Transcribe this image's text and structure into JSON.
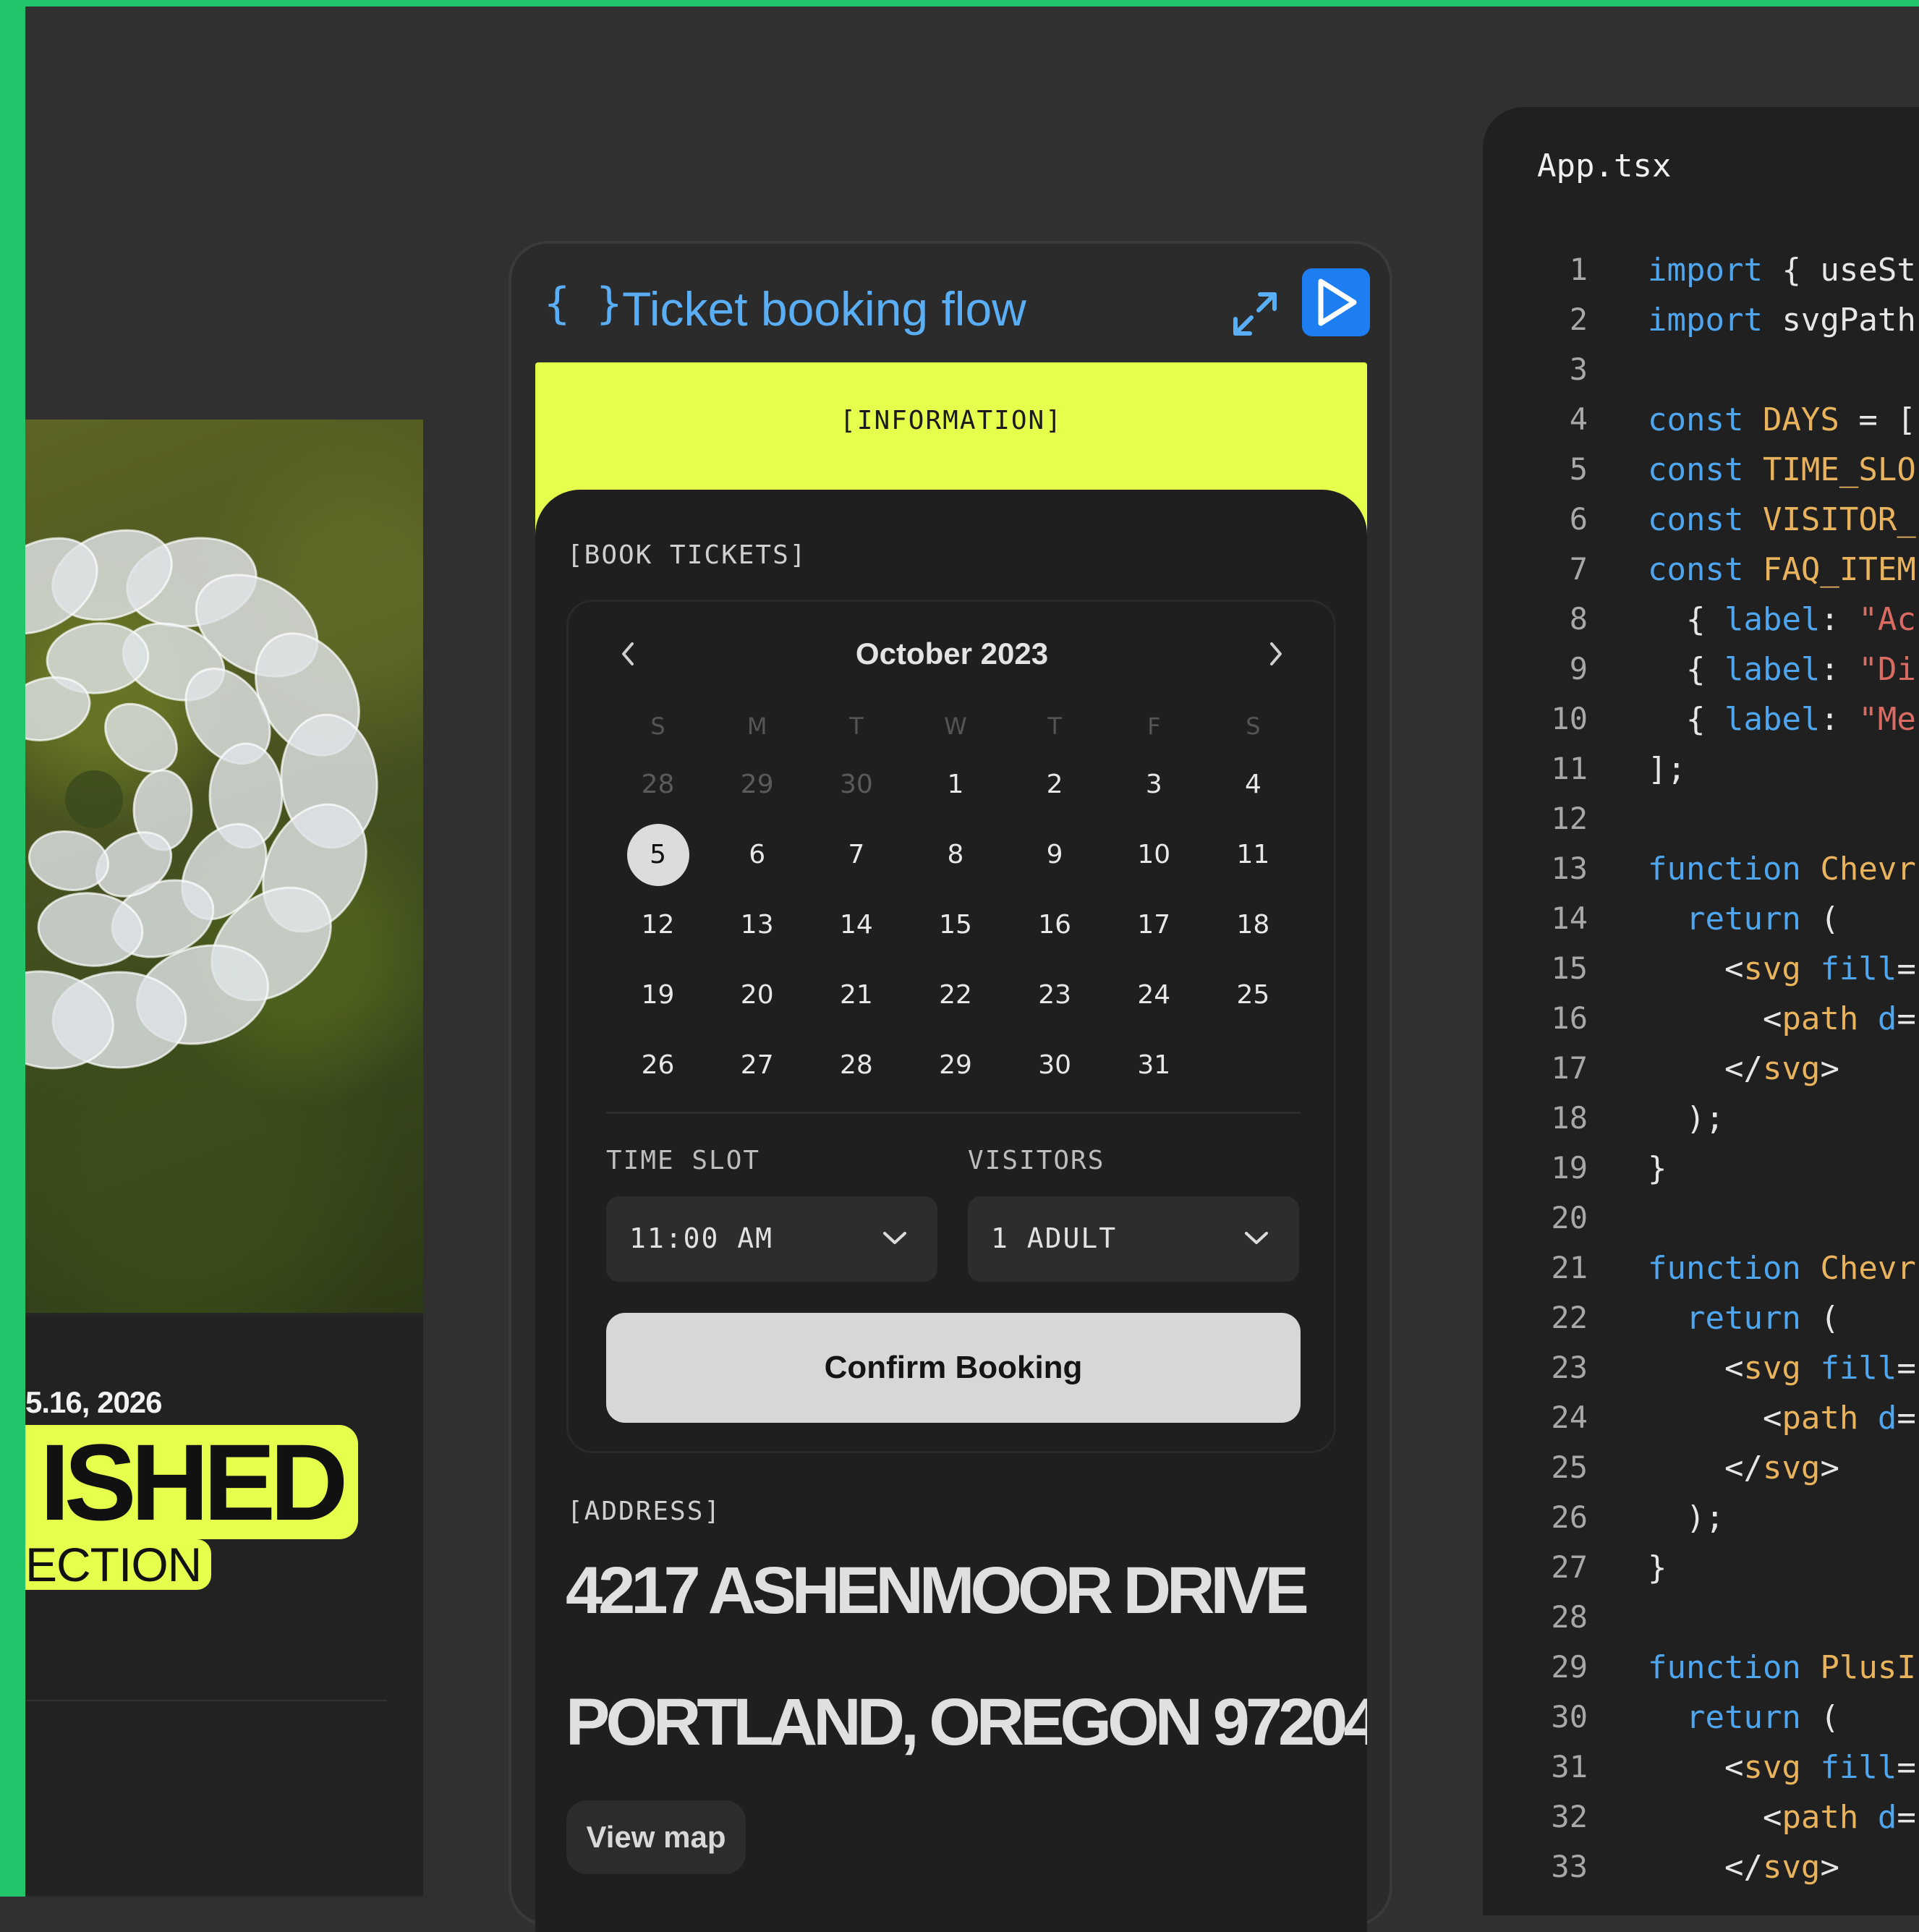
{
  "left_card": {
    "date": "5.16, 2026",
    "headline": "ISHED",
    "subline": "ECTION"
  },
  "widget": {
    "braces": "{ }",
    "title": "Ticket booking flow",
    "expand_icon": "expand-icon",
    "run_icon": "play-icon",
    "info_label": "[INFORMATION]",
    "book_label": "[BOOK TICKETS]",
    "calendar": {
      "month": "October 2023",
      "weekdays": [
        "S",
        "M",
        "T",
        "W",
        "T",
        "F",
        "S"
      ],
      "weeks": [
        [
          "28",
          "29",
          "30",
          "1",
          "2",
          "3",
          "4"
        ],
        [
          "5",
          "6",
          "7",
          "8",
          "9",
          "10",
          "11"
        ],
        [
          "12",
          "13",
          "14",
          "15",
          "16",
          "17",
          "18"
        ],
        [
          "19",
          "20",
          "21",
          "22",
          "23",
          "24",
          "25"
        ],
        [
          "26",
          "27",
          "28",
          "29",
          "30",
          "31",
          ""
        ]
      ],
      "selected": "5"
    },
    "time_slot": {
      "label": "TIME SLOT",
      "value": "11:00 AM"
    },
    "visitors": {
      "label": "VISITORS",
      "value": "1 ADULT"
    },
    "confirm_label": "Confirm Booking",
    "address_label": "[ADDRESS]",
    "address_line1": "4217 ASHENMOOR DRIVE",
    "address_line2": "PORTLAND, OREGON 97204",
    "view_map_label": "View map"
  },
  "editor": {
    "tab": "App.tsx",
    "lines": [
      [
        [
          "import",
          "kw"
        ],
        [
          " { useSt",
          ""
        ]
      ],
      [
        [
          "import",
          "kw"
        ],
        [
          " svgPath",
          ""
        ]
      ],
      [],
      [
        [
          "const",
          "kw"
        ],
        [
          " ",
          ""
        ],
        [
          "DAYS",
          "nm"
        ],
        [
          " = [",
          ""
        ]
      ],
      [
        [
          "const",
          "kw"
        ],
        [
          " ",
          ""
        ],
        [
          "TIME_SLO",
          "nm"
        ]
      ],
      [
        [
          "const",
          "kw"
        ],
        [
          " ",
          ""
        ],
        [
          "VISITOR_",
          "nm"
        ]
      ],
      [
        [
          "const",
          "kw"
        ],
        [
          " ",
          ""
        ],
        [
          "FAQ_ITEM",
          "nm"
        ]
      ],
      [
        [
          "  { ",
          ""
        ],
        [
          "label",
          "kw"
        ],
        [
          ": ",
          ""
        ],
        [
          "\"Ac",
          "str"
        ]
      ],
      [
        [
          "  { ",
          ""
        ],
        [
          "label",
          "kw"
        ],
        [
          ": ",
          ""
        ],
        [
          "\"Di",
          "str"
        ]
      ],
      [
        [
          "  { ",
          ""
        ],
        [
          "label",
          "kw"
        ],
        [
          ": ",
          ""
        ],
        [
          "\"Me",
          "str"
        ]
      ],
      [
        [
          "];",
          ""
        ]
      ],
      [],
      [
        [
          "function",
          "kw"
        ],
        [
          " ",
          ""
        ],
        [
          "Chevr",
          "nm"
        ]
      ],
      [
        [
          "  ",
          ""
        ],
        [
          "return",
          "kw"
        ],
        [
          " (",
          ""
        ]
      ],
      [
        [
          "    <",
          ""
        ],
        [
          "svg",
          "nm"
        ],
        [
          " ",
          ""
        ],
        [
          "fill",
          "kw"
        ],
        [
          "=",
          ""
        ]
      ],
      [
        [
          "      <",
          ""
        ],
        [
          "path",
          "nm"
        ],
        [
          " ",
          ""
        ],
        [
          "d",
          "kw"
        ],
        [
          "=",
          ""
        ]
      ],
      [
        [
          "    </",
          ""
        ],
        [
          "svg",
          "nm"
        ],
        [
          ">",
          ""
        ]
      ],
      [
        [
          "  );",
          ""
        ]
      ],
      [
        [
          "}",
          ""
        ]
      ],
      [],
      [
        [
          "function",
          "kw"
        ],
        [
          " ",
          ""
        ],
        [
          "Chevr",
          "nm"
        ]
      ],
      [
        [
          "  ",
          ""
        ],
        [
          "return",
          "kw"
        ],
        [
          " (",
          ""
        ]
      ],
      [
        [
          "    <",
          ""
        ],
        [
          "svg",
          "nm"
        ],
        [
          " ",
          ""
        ],
        [
          "fill",
          "kw"
        ],
        [
          "=",
          ""
        ]
      ],
      [
        [
          "      <",
          ""
        ],
        [
          "path",
          "nm"
        ],
        [
          " ",
          ""
        ],
        [
          "d",
          "kw"
        ],
        [
          "=",
          ""
        ]
      ],
      [
        [
          "    </",
          ""
        ],
        [
          "svg",
          "nm"
        ],
        [
          ">",
          ""
        ]
      ],
      [
        [
          "  );",
          ""
        ]
      ],
      [
        [
          "}",
          ""
        ]
      ],
      [],
      [
        [
          "function",
          "kw"
        ],
        [
          " ",
          ""
        ],
        [
          "PlusI",
          "nm"
        ]
      ],
      [
        [
          "  ",
          ""
        ],
        [
          "return",
          "kw"
        ],
        [
          " (",
          ""
        ]
      ],
      [
        [
          "    <",
          ""
        ],
        [
          "svg",
          "nm"
        ],
        [
          " ",
          ""
        ],
        [
          "fill",
          "kw"
        ],
        [
          "=",
          ""
        ]
      ],
      [
        [
          "      <",
          ""
        ],
        [
          "path",
          "nm"
        ],
        [
          " ",
          ""
        ],
        [
          "d",
          "kw"
        ],
        [
          "=",
          ""
        ]
      ],
      [
        [
          "    </",
          ""
        ],
        [
          "svg",
          "nm"
        ],
        [
          ">",
          ""
        ]
      ]
    ]
  },
  "colors": {
    "accent_green": "#21c66a",
    "accent_lime": "#e6ff4d",
    "accent_blue": "#1c7ef0",
    "keyword_blue": "#4fa6ee",
    "name_orange": "#e8b35c",
    "string_red": "#d96b62"
  }
}
